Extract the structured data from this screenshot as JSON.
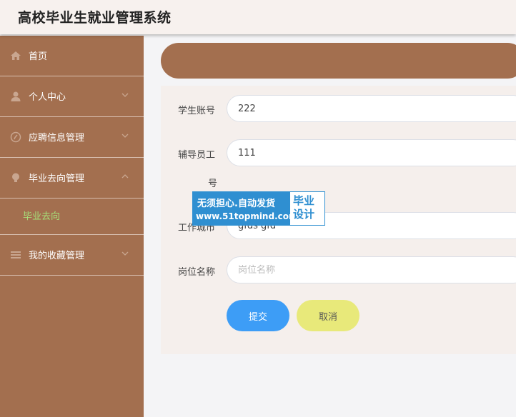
{
  "header": {
    "title": "高校毕业生就业管理系统"
  },
  "sidebar": {
    "items": [
      {
        "label": "首页",
        "icon": "home-icon"
      },
      {
        "label": "个人中心",
        "icon": "user-icon"
      },
      {
        "label": "应聘信息管理",
        "icon": "compass-icon"
      },
      {
        "label": "毕业去向管理",
        "icon": "lightbulb-icon"
      },
      {
        "label": "我的收藏管理",
        "icon": "list-icon"
      }
    ],
    "submenu": {
      "label": "毕业去向"
    }
  },
  "form": {
    "fields": [
      {
        "label": "学生账号",
        "value": "222",
        "placeholder": ""
      },
      {
        "label_part1": "辅导员工",
        "label_part2": "号",
        "value": "111",
        "placeholder": ""
      },
      {
        "label": "工作城市",
        "value": "gfds gfd",
        "placeholder": ""
      },
      {
        "label": "岗位名称",
        "value": "",
        "placeholder": "岗位名称"
      }
    ],
    "submit_label": "提交",
    "cancel_label": "取消"
  },
  "watermark": {
    "line1": "无须担心.自动发货",
    "line2": "www.51topmind.com",
    "right_line1": "毕业",
    "right_line2": "设计"
  },
  "colors": {
    "sidebar": "#a36f4f",
    "submenu_active": "#a6e07a",
    "submit": "#3d9df6",
    "cancel": "#e8e97a"
  }
}
